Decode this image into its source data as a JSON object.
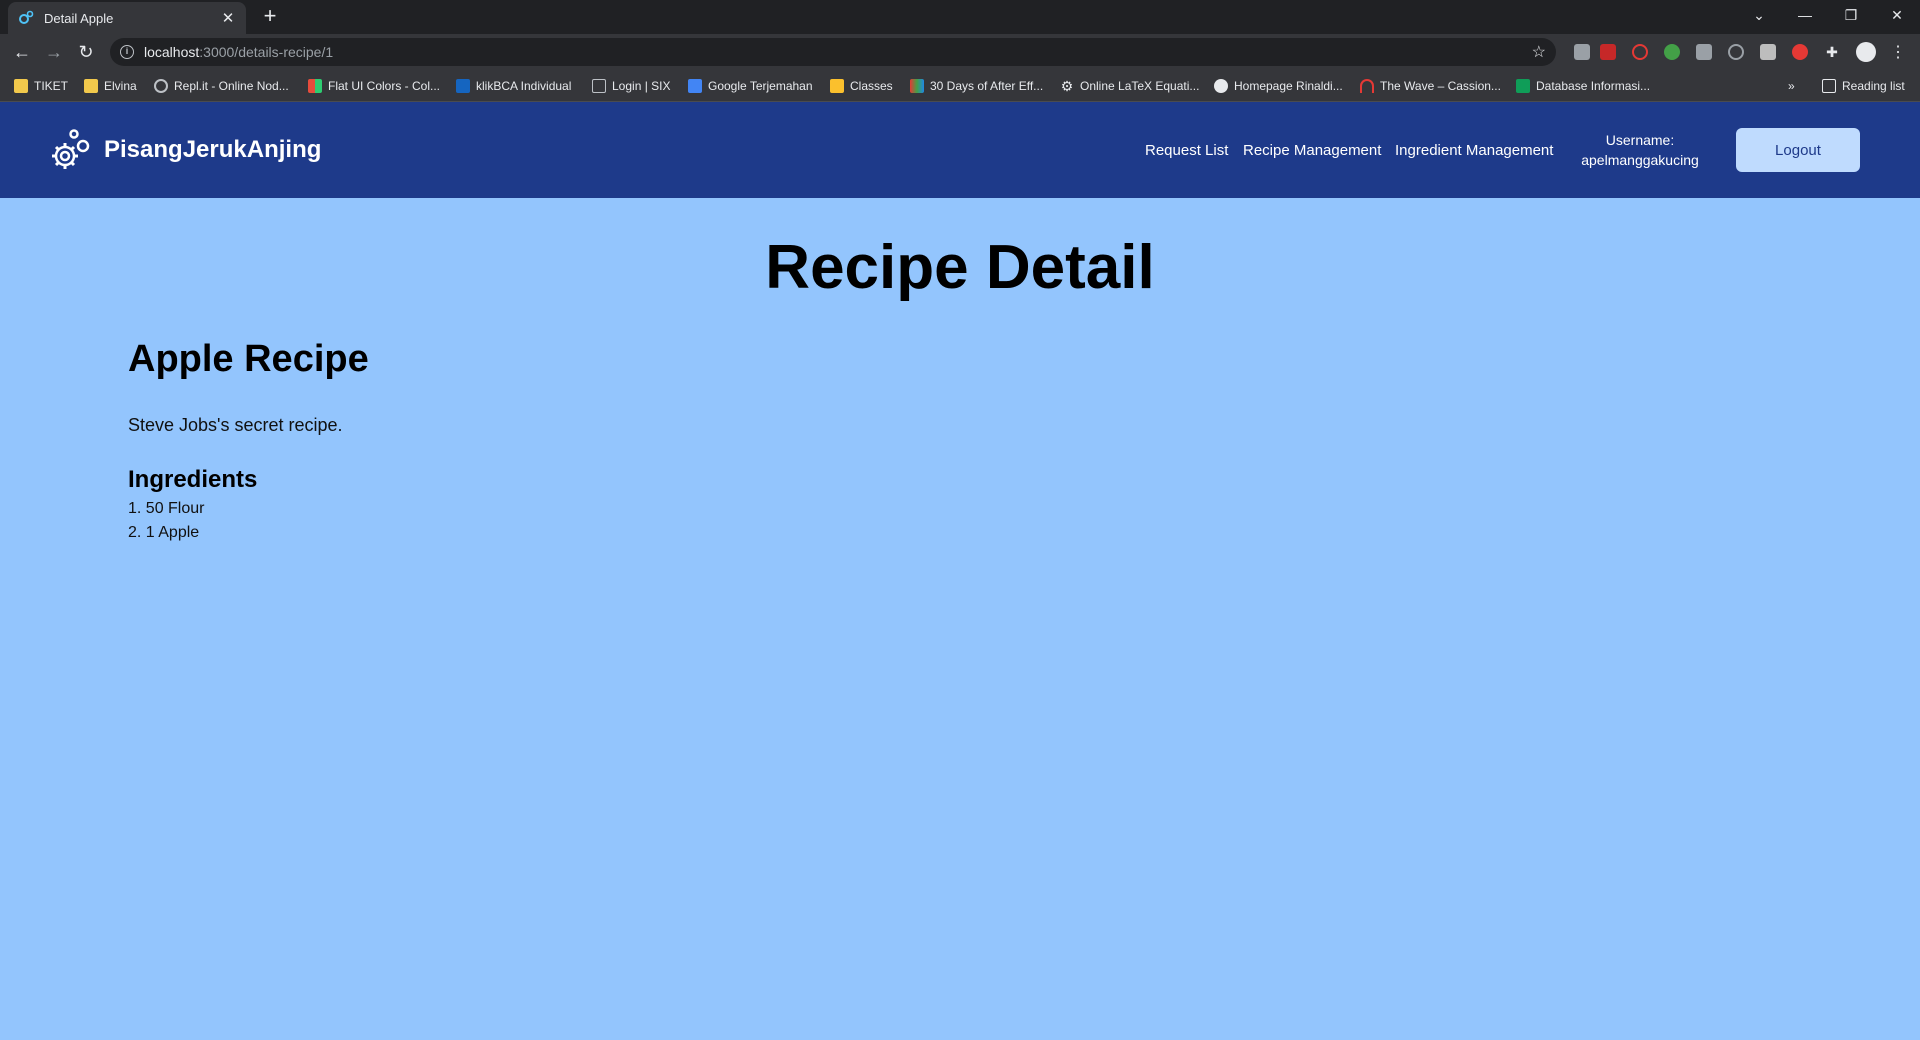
{
  "browser": {
    "tab_title": "Detail Apple",
    "new_tab": "+",
    "url_host": "localhost",
    "url_path": ":3000/details-recipe/1",
    "bookmarks": [
      {
        "label": "TIKET",
        "icon": "folder-icon"
      },
      {
        "label": "Elvina",
        "icon": "folder-icon"
      },
      {
        "label": "Repl.it - Online Nod...",
        "icon": "replit-icon"
      },
      {
        "label": "Flat UI Colors - Col...",
        "icon": "flatui-icon"
      },
      {
        "label": "klikBCA Individual",
        "icon": "bca-icon"
      },
      {
        "label": "Login | SIX",
        "icon": "six-icon"
      },
      {
        "label": "Google Terjemahan",
        "icon": "translate-icon"
      },
      {
        "label": "Classes",
        "icon": "classes-icon"
      },
      {
        "label": "30 Days of After Eff...",
        "icon": "chart-icon"
      },
      {
        "label": "Online LaTeX Equati...",
        "icon": "gear-icon"
      },
      {
        "label": "Homepage Rinaldi...",
        "icon": "globe-icon"
      },
      {
        "label": "The Wave – Cassion...",
        "icon": "wave-icon"
      },
      {
        "label": "Database Informasi...",
        "icon": "sheets-icon"
      }
    ],
    "reading_list": "Reading list"
  },
  "navbar": {
    "brand": "PisangJerukAnjing",
    "links": [
      "Request List",
      "Recipe Management",
      "Ingredient Management"
    ],
    "username_label": "Username:",
    "username": "apelmanggakucing",
    "logout": "Logout"
  },
  "main": {
    "page_title": "Recipe Detail",
    "recipe_name": "Apple Recipe",
    "description": "Steve Jobs's secret recipe.",
    "ingredients_heading": "Ingredients",
    "ingredients": [
      "1. 50 Flour",
      "2. 1 Apple"
    ]
  },
  "colors": {
    "navbar_bg": "#1e3a8a",
    "page_bg": "#93c5fd",
    "logout_bg": "#bfdbfe"
  }
}
